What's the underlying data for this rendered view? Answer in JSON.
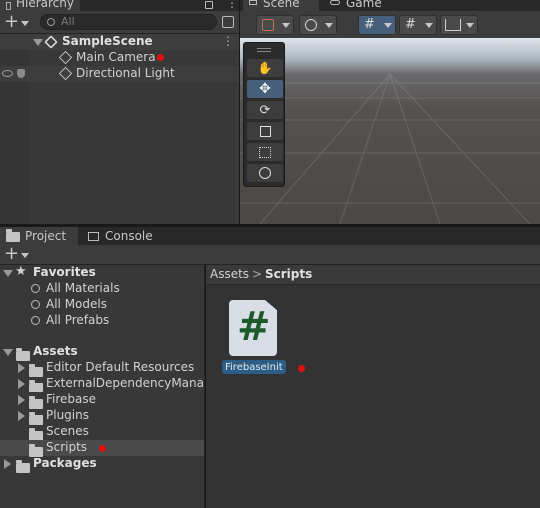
{
  "hierarchy": {
    "tab_label": "Hierarchy",
    "search_placeholder": "All",
    "scene_name": "SampleScene",
    "items": [
      {
        "label": "Main Camera"
      },
      {
        "label": "Directional Light"
      }
    ]
  },
  "scene_view": {
    "tabs": [
      {
        "label": "Scene"
      },
      {
        "label": "Game"
      }
    ],
    "tools": [
      "hand-tool",
      "move-tool",
      "rotate-tool",
      "scale-tool",
      "rect-tool",
      "transform-tool"
    ],
    "active_tool": "move-tool"
  },
  "project": {
    "tabs": [
      {
        "label": "Project"
      },
      {
        "label": "Console"
      }
    ],
    "favorites": {
      "label": "Favorites",
      "items": [
        "All Materials",
        "All Models",
        "All Prefabs"
      ]
    },
    "assets": {
      "label": "Assets",
      "folders": [
        "Editor Default Resources",
        "ExternalDependencyManager",
        "Firebase",
        "Plugins",
        "Scenes",
        "Scripts"
      ]
    },
    "packages_label": "Packages",
    "breadcrumb": {
      "root": "Assets",
      "separator": ">",
      "current": "Scripts"
    },
    "files": [
      {
        "name": "FirebaseInit",
        "icon_glyph": "#"
      }
    ]
  },
  "colors": {
    "selection": "#3d3d3d",
    "highlight": "#2c5d87",
    "error_dot": "#e01010",
    "script_glyph": "#1d5b2a"
  }
}
